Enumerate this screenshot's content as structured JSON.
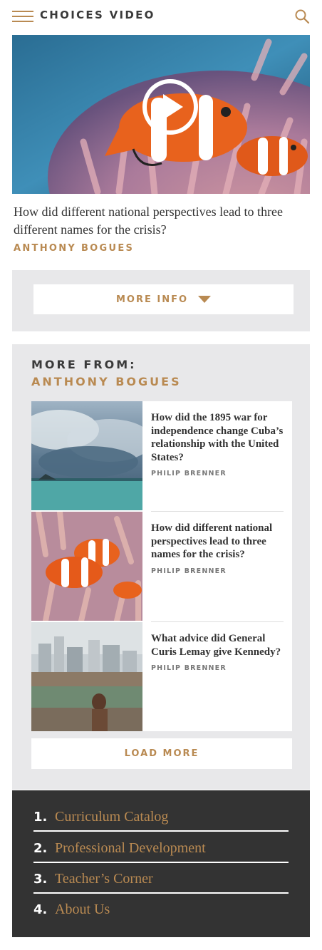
{
  "header": {
    "brand": "CHOICES VIDEO",
    "menu_icon": "hamburger-menu-icon",
    "search_icon": "search-icon"
  },
  "video": {
    "play_icon": "play-icon",
    "title": "How did different national perspectives lead to three different names for the crisis?",
    "author": "ANTHONY BOGUES"
  },
  "info": {
    "button_label": "MORE INFO",
    "button_icon": "caret-down-icon"
  },
  "more_from": {
    "heading": "MORE FROM:",
    "author": "ANTHONY BOGUES",
    "items": [
      {
        "question": "How did the 1895 war for independence change Cuba’s relationship with the United States?",
        "byline": "PHILIP BRENNER",
        "thumb": "storm-over-sea-image"
      },
      {
        "question": "How did different national perspectives lead to three names for the crisis?",
        "byline": "PHILIP BRENNER",
        "thumb": "clownfish-image"
      },
      {
        "question": "What advice did General Curis Lemay give Kennedy?",
        "byline": "PHILIP BRENNER",
        "thumb": "city-slum-image"
      }
    ],
    "load_more": "LOAD MORE"
  },
  "footer": {
    "nav": [
      {
        "num": "1.",
        "label": "Curriculum Catalog"
      },
      {
        "num": "2.",
        "label": "Professional Development"
      },
      {
        "num": "3.",
        "label": "Teacher’s Corner"
      },
      {
        "num": "4.",
        "label": "About Us"
      }
    ]
  },
  "colors": {
    "accent": "#b98a52",
    "panel": "#e8e8ea",
    "footer": "#333333",
    "text": "#333333"
  }
}
